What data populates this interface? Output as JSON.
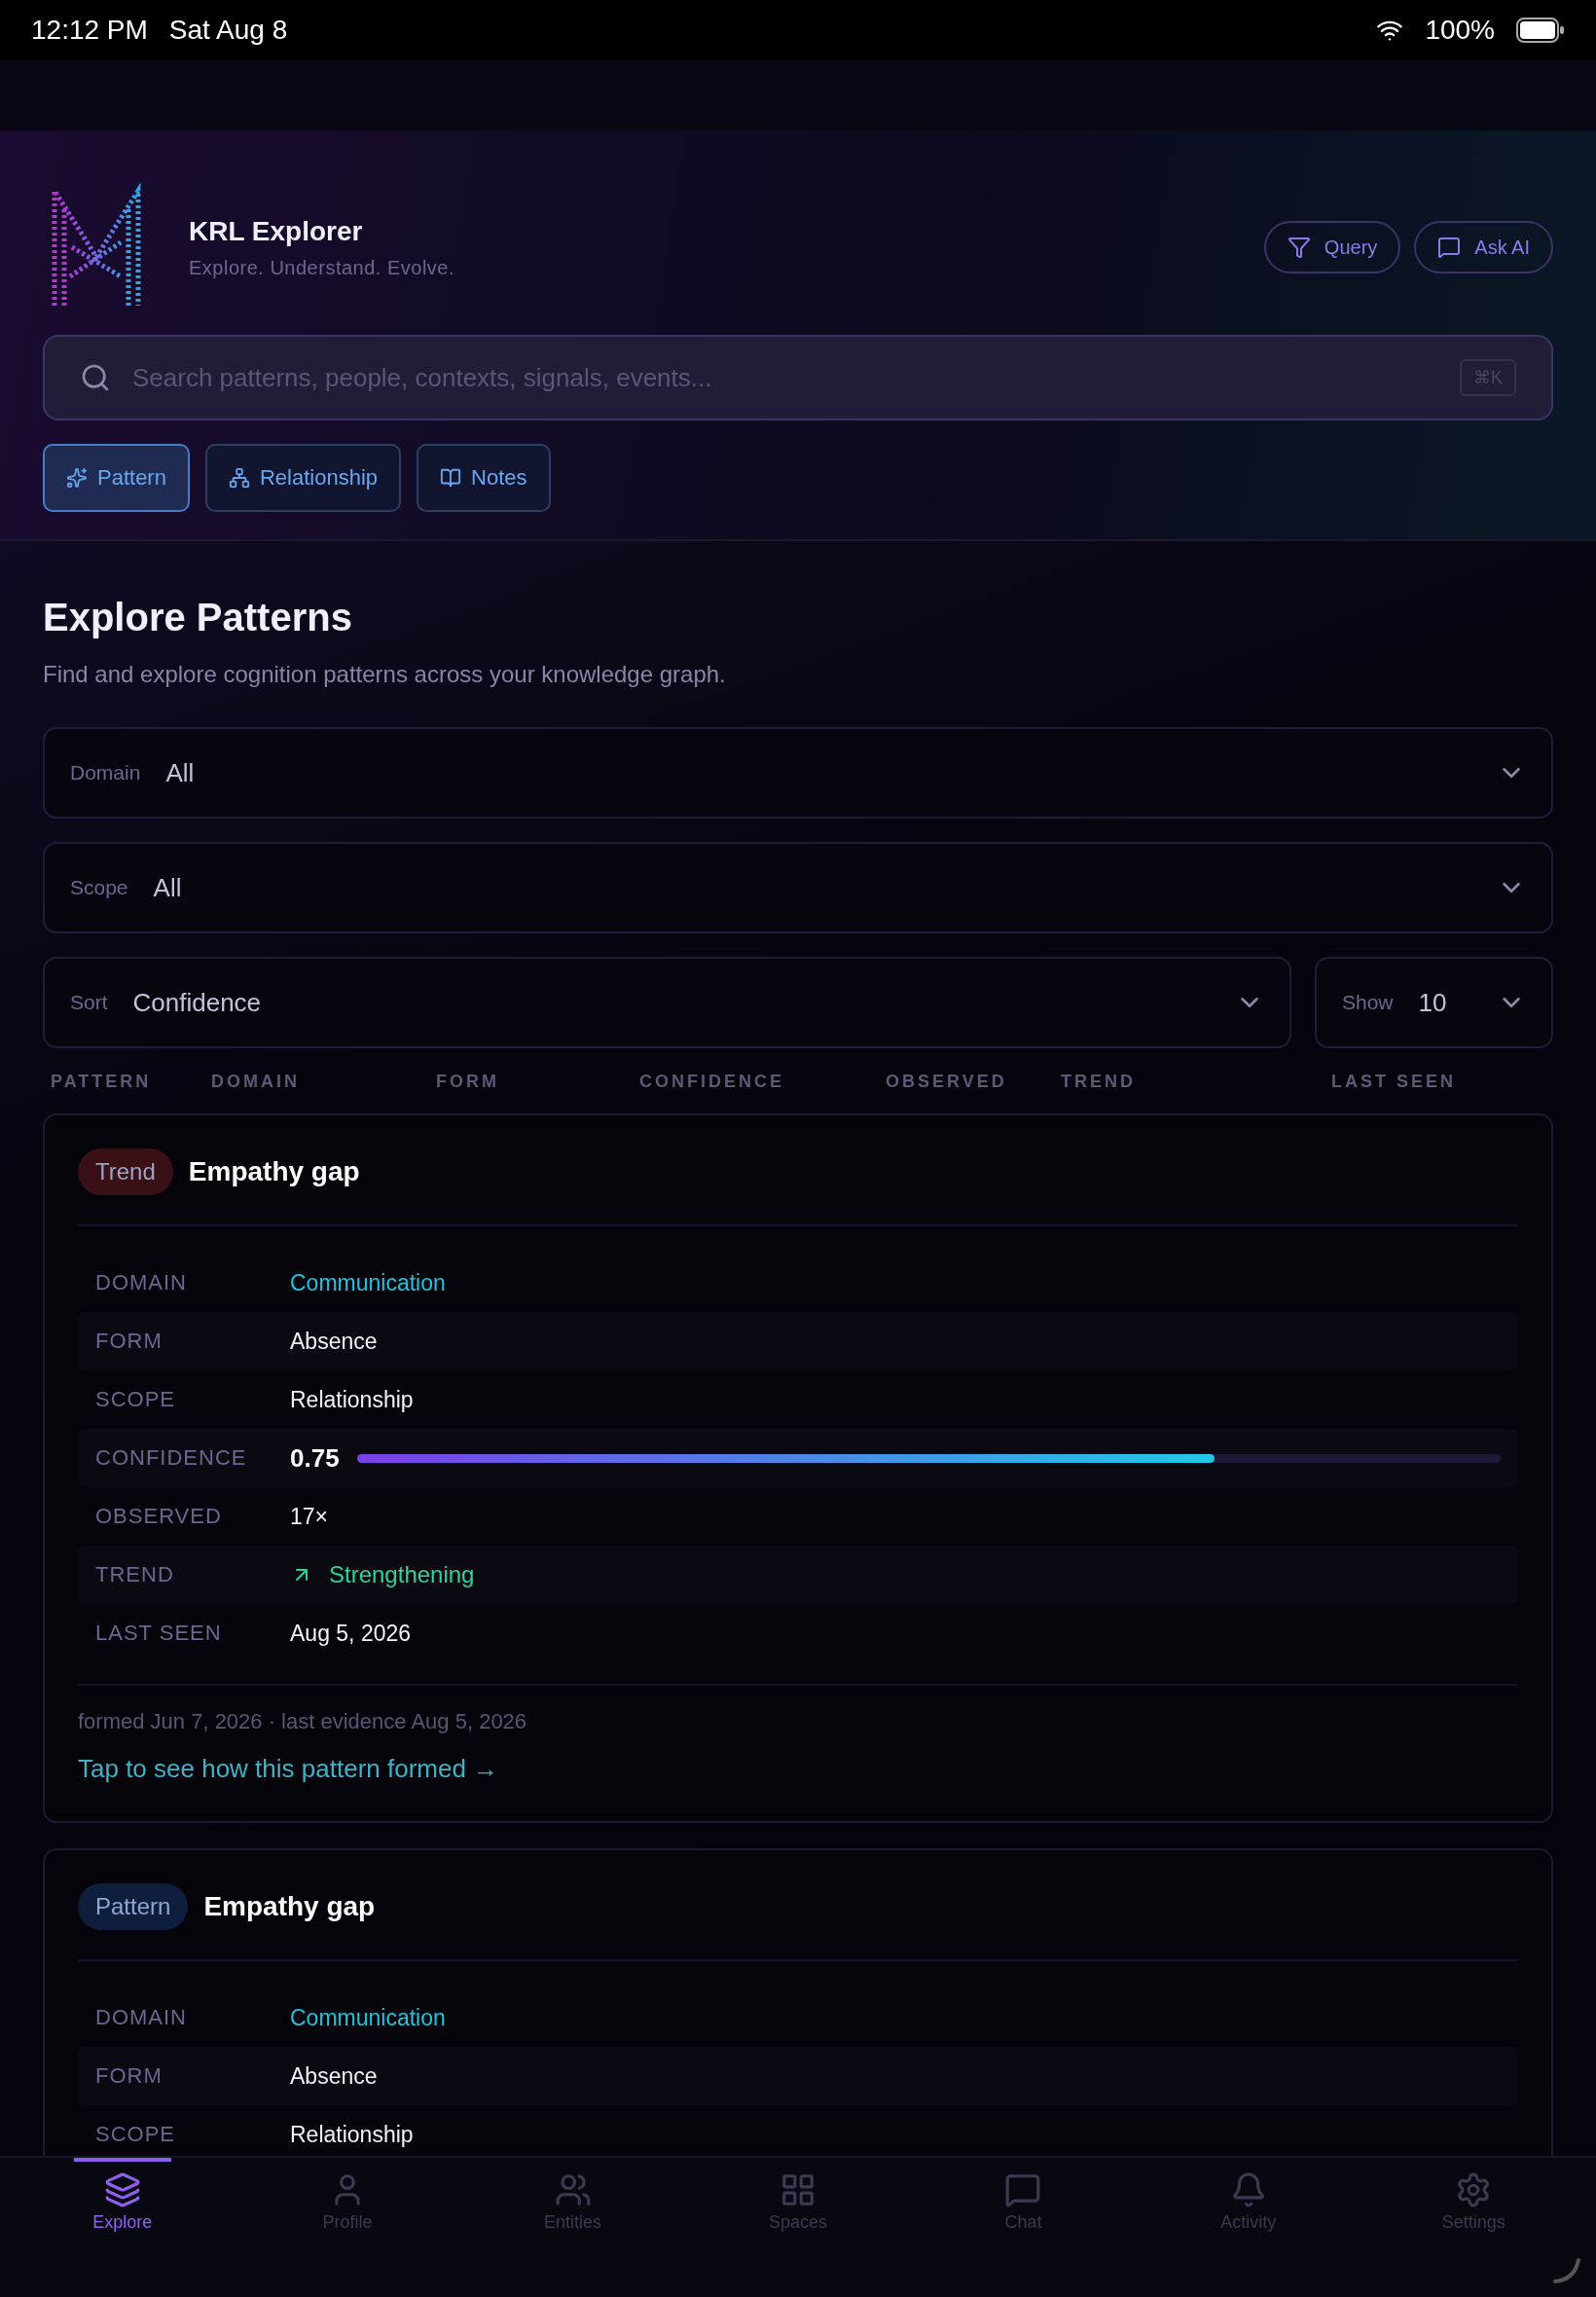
{
  "status_bar": {
    "time": "12:12 PM",
    "date": "Sat Aug 8",
    "battery": "100%"
  },
  "header": {
    "title": "KRL Explorer",
    "subtitle": "Explore. Understand. Evolve.",
    "actions": [
      {
        "label": "Query"
      },
      {
        "label": "Ask AI"
      }
    ]
  },
  "search": {
    "placeholder": "Search patterns, people, contexts, signals, events...",
    "shortcut": "⌘K"
  },
  "modes": [
    {
      "label": "Pattern",
      "selected": true
    },
    {
      "label": "Relationship",
      "selected": false
    },
    {
      "label": "Notes",
      "selected": false
    }
  ],
  "section": {
    "title": "Explore Patterns",
    "description": "Find and explore cognition patterns across your knowledge graph."
  },
  "filters": [
    {
      "label": "Domain",
      "value": "All"
    },
    {
      "label": "Scope",
      "value": "All"
    },
    {
      "label": "Sort",
      "value": "Confidence"
    },
    {
      "label": "Show",
      "value": "10"
    }
  ],
  "table": {
    "columns": [
      "PATTERN",
      "DOMAIN",
      "FORM",
      "CONFIDENCE",
      "OBSERVED",
      "TREND",
      "LAST SEEN"
    ]
  },
  "cards": [
    {
      "badge": "Trend",
      "color": "#3a1017",
      "title": "Empathy gap",
      "rows": [
        {
          "kind": "link",
          "label": "DOMAIN",
          "value": "Communication"
        },
        {
          "kind": "text",
          "label": "FORM",
          "value": "Absence"
        },
        {
          "kind": "text",
          "label": "SCOPE",
          "value": "Relationship"
        },
        {
          "kind": "confidence",
          "label": "CONFIDENCE",
          "value": "0.75",
          "level": 0.75
        },
        {
          "kind": "text",
          "label": "OBSERVED",
          "value": "17×"
        },
        {
          "kind": "trend",
          "label": "TREND",
          "value": "Strengthening"
        },
        {
          "kind": "text",
          "label": "LAST SEEN",
          "value": "Aug 5, 2026"
        }
      ],
      "footnote": "formed Jun 7, 2026 · last evidence Aug 5, 2026",
      "link": "Tap to see how this pattern formed →"
    },
    {
      "badge": "Pattern",
      "color": "#101e3e",
      "title": "Empathy gap",
      "rows": [
        {
          "kind": "link",
          "label": "DOMAIN",
          "value": "Communication"
        },
        {
          "kind": "text",
          "label": "FORM",
          "value": "Absence"
        },
        {
          "kind": "text",
          "label": "SCOPE",
          "value": "Relationship"
        }
      ]
    }
  ],
  "tab_bar": [
    {
      "label": "Explore",
      "selected": true
    },
    {
      "label": "Profile",
      "selected": false
    },
    {
      "label": "Entities",
      "selected": false
    },
    {
      "label": "Spaces",
      "selected": false
    },
    {
      "label": "Chat",
      "selected": false
    },
    {
      "label": "Activity",
      "selected": false
    },
    {
      "label": "Settings",
      "selected": false
    }
  ]
}
